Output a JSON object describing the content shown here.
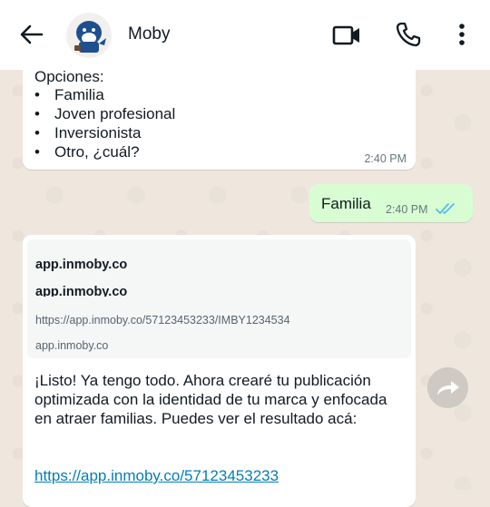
{
  "header": {
    "contact_name": "Moby"
  },
  "messages": {
    "options_message": {
      "heading": "Opciones:",
      "items": [
        "Familia",
        "Joven profesional",
        "Inversionista",
        "Otro, ¿cuál?"
      ],
      "bullet": "•",
      "time": "2:40 PM"
    },
    "reply": {
      "text": "Familia",
      "time": "2:40 PM",
      "status": "read"
    },
    "link_message": {
      "preview": {
        "title": "app.inmoby.co",
        "title_repeat": "app.inmoby.co",
        "url": "https://app.inmoby.co/57123453233/IMBY1234534",
        "domain": "app.inmoby.co"
      },
      "body": "¡Listo! Ya tengo todo. Ahora crearé tu publicación optimizada con la identidad de tu marca y enfocada en atraer familias. Puedes ver el resultado acá:",
      "link": "https://app.inmoby.co/57123453233"
    }
  },
  "colors": {
    "accent_ticks": "#53bdeb",
    "outgoing_bubble": "#d9fdd3",
    "link": "#027eb5"
  }
}
